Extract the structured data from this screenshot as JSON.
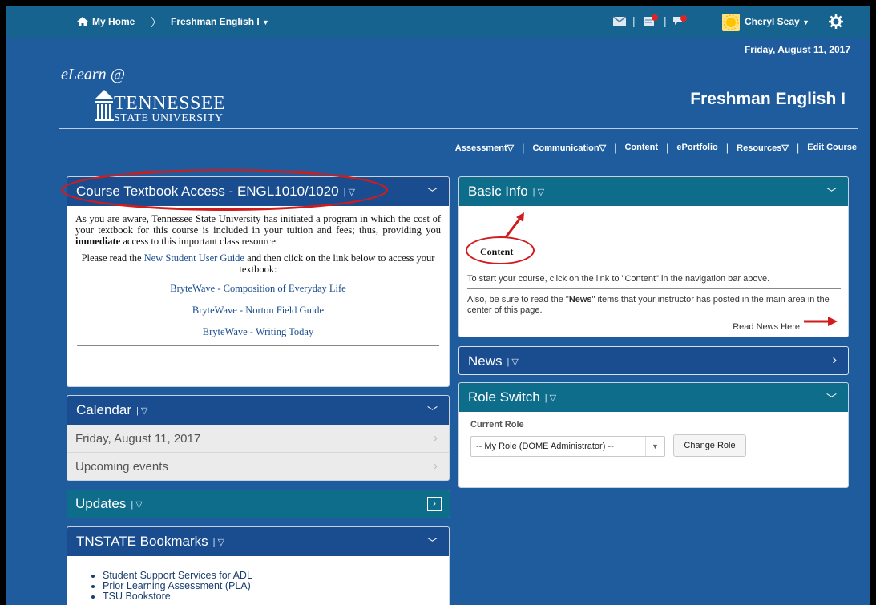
{
  "topnav": {
    "home": "My Home",
    "course": "Freshman English I",
    "user": "Cheryl Seay"
  },
  "header": {
    "date": "Friday, August 11, 2017",
    "logo_elearn": "eLearn @",
    "logo_name": "TENNESSEE",
    "logo_sub": "STATE UNIVERSITY",
    "course_title": "Freshman English I"
  },
  "course_nav": [
    {
      "label": "Assessment",
      "dropdown": true
    },
    {
      "label": "Communication",
      "dropdown": true
    },
    {
      "label": "Content",
      "dropdown": false
    },
    {
      "label": "ePortfolio",
      "dropdown": false
    },
    {
      "label": "Resources",
      "dropdown": true
    },
    {
      "label": "Edit Course",
      "dropdown": false
    }
  ],
  "textbook": {
    "title": "Course Textbook Access - ENGL1010/1020",
    "para1_a": "As you are aware, Tennessee State University has initiated a program in which the cost of your textbook for this course is included in your tuition and fees; thus, providing you ",
    "para1_bold": "immediate",
    "para1_b": " access to this important class resource.",
    "para2_a": "Please read the ",
    "para2_link": "New Student User Guide",
    "para2_b": " and then click on the link below to access your textbook:",
    "links": [
      "BryteWave - Composition of Everyday Life",
      "BryteWave - Norton Field Guide",
      "BryteWave - Writing Today"
    ]
  },
  "calendar": {
    "title": "Calendar",
    "rows": [
      "Friday, August 11, 2017",
      "Upcoming events"
    ]
  },
  "updates": {
    "title": "Updates"
  },
  "bookmarks": {
    "title": "TNSTATE Bookmarks",
    "items": [
      "Student Support Services for ADL",
      "Prior Learning Assessment (PLA)",
      "TSU Bookstore"
    ]
  },
  "basic_info": {
    "title": "Basic Info",
    "content_link": "Content",
    "line1": "To start your course, click on the link to \"Content\" in the navigation bar above.",
    "line2_a": "Also, be sure to read the \"",
    "line2_bold": "News",
    "line2_b": "\" items that your instructor has posted in the main area in the center of this page.",
    "read_news": "Read News Here"
  },
  "news": {
    "title": "News"
  },
  "role_switch": {
    "title": "Role Switch",
    "label": "Current Role",
    "select_value": "-- My Role (DOME Administrator) --",
    "button": "Change Role"
  },
  "colors": {
    "teal": "#0f6d8c",
    "navy": "#1a4d8f",
    "page_bg": "#1f5c9e",
    "annotation": "#d01c1c"
  }
}
